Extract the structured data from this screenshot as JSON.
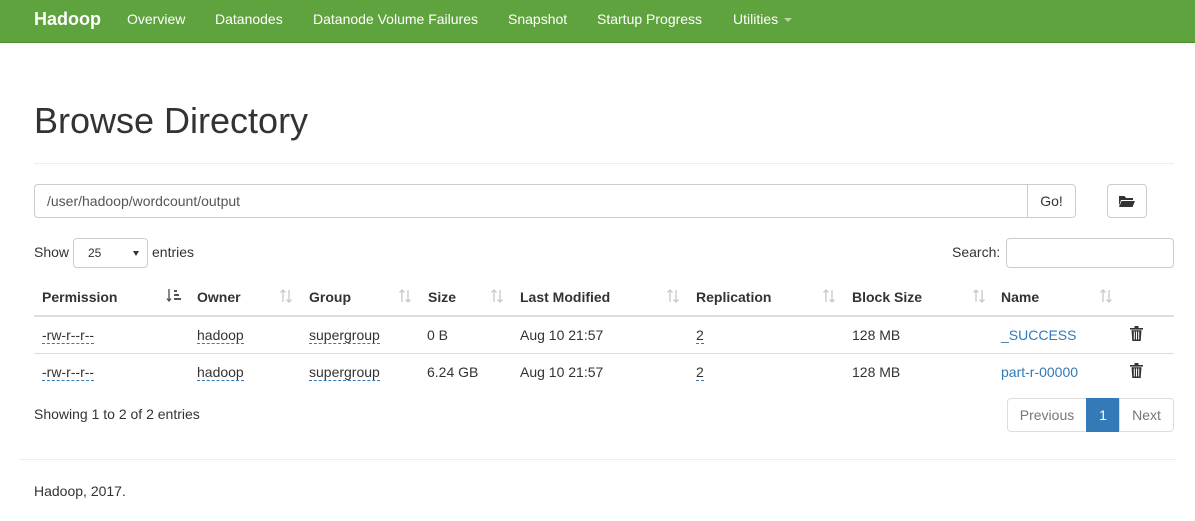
{
  "navbar": {
    "brand": "Hadoop",
    "items": [
      "Overview",
      "Datanodes",
      "Datanode Volume Failures",
      "Snapshot",
      "Startup Progress",
      "Utilities"
    ],
    "bg_color": "#5fa33e"
  },
  "page_title": "Browse Directory",
  "path_bar": {
    "value": "/user/hadoop/wordcount/output",
    "go_label": "Go!",
    "folder_icon": "folder-open-icon"
  },
  "length_control": {
    "show_label": "Show",
    "selected": "25",
    "entries_label": "entries"
  },
  "search": {
    "label": "Search:",
    "value": ""
  },
  "table": {
    "columns": [
      "Permission",
      "Owner",
      "Group",
      "Size",
      "Last Modified",
      "Replication",
      "Block Size",
      "Name"
    ],
    "rows": [
      {
        "permission": "-rw-r--r--",
        "owner": "hadoop",
        "group": "supergroup",
        "size": "0 B",
        "modified": "Aug 10 21:57",
        "replication": "2",
        "block_size": "128 MB",
        "name": "_SUCCESS"
      },
      {
        "permission": "-rw-r--r--",
        "owner": "hadoop",
        "group": "supergroup",
        "size": "6.24 GB",
        "modified": "Aug 10 21:57",
        "replication": "2",
        "block_size": "128 MB",
        "name": "part-r-00000"
      }
    ]
  },
  "info": "Showing 1 to 2 of 2 entries",
  "pagination": {
    "previous": "Previous",
    "current": "1",
    "next": "Next"
  },
  "footer": "Hadoop, 2017.",
  "colors": {
    "link": "#337ab7",
    "active_page": "#337ab7"
  }
}
